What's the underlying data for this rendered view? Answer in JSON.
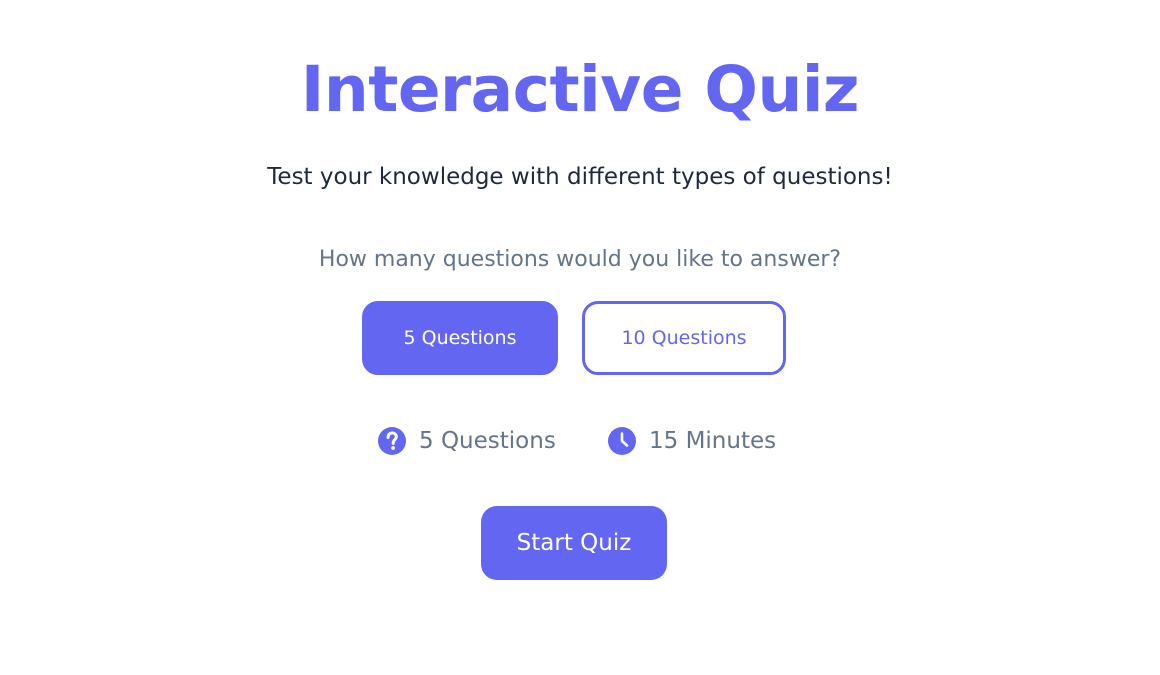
{
  "header": {
    "title": "Interactive Quiz",
    "subtitle": "Test your knowledge with different types of questions!"
  },
  "question_count": {
    "prompt": "How many questions would you like to answer?",
    "options": [
      {
        "label": "5 Questions",
        "selected": true
      },
      {
        "label": "10 Questions",
        "selected": false
      }
    ]
  },
  "summary": {
    "questions": {
      "icon": "question-circle-icon",
      "text": "5 Questions"
    },
    "duration": {
      "icon": "clock-icon",
      "text": "15 Minutes"
    }
  },
  "actions": {
    "start_label": "Start Quiz"
  },
  "colors": {
    "accent": "#6366f1",
    "text_dark": "#1e293b",
    "text_muted": "#64748b",
    "background": "#ffffff"
  }
}
